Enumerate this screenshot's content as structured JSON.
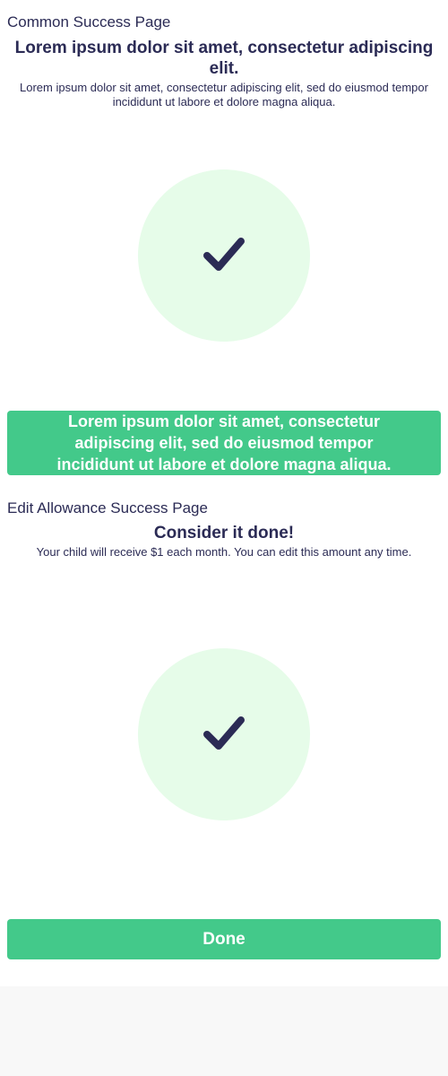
{
  "common": {
    "label": "Common Success Page",
    "headline": "Lorem ipsum dolor sit amet, consectetur adipiscing elit.",
    "subtext": "Lorem ipsum dolor sit amet, consectetur adipiscing elit, sed do eiusmod tempor incididunt ut labore et dolore magna aliqua.",
    "button_label": "Lorem ipsum dolor sit amet, consectetur adipiscing elit, sed do eiusmod tempor incididunt ut labore et dolore magna aliqua."
  },
  "allowance": {
    "label": "Edit Allowance Success Page",
    "headline": "Consider it done!",
    "subtext": "Your child will receive $1 each month. You can edit this amount any time.",
    "button_label": "Done"
  },
  "colors": {
    "accent": "#43c98a",
    "circle": "#e6fce9",
    "text": "#2b2b55"
  },
  "icons": {
    "success": "check-icon"
  }
}
